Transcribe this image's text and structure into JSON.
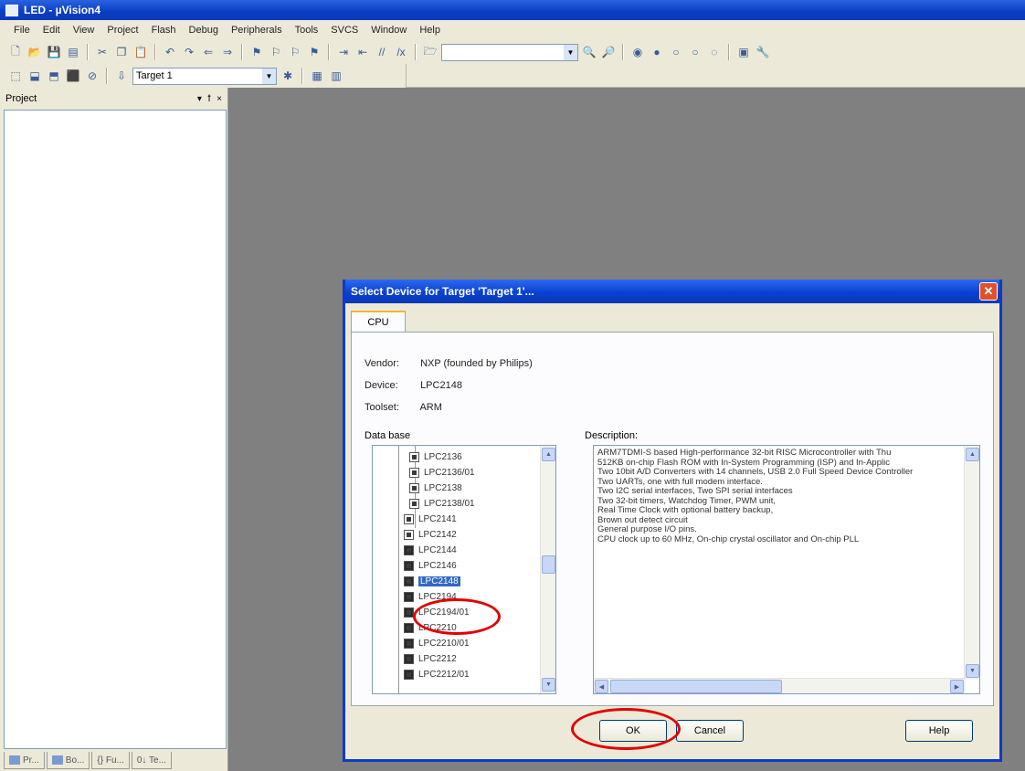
{
  "window": {
    "title": "LED - µVision4"
  },
  "menu": [
    "File",
    "Edit",
    "View",
    "Project",
    "Flash",
    "Debug",
    "Peripherals",
    "Tools",
    "SVCS",
    "Window",
    "Help"
  ],
  "toolbar2": {
    "target_value": "Target 1"
  },
  "project_panel": {
    "title": "Project",
    "controls": [
      "▾",
      "ꝉ",
      "×"
    ],
    "tabs": [
      "Pr...",
      "Bo...",
      "{} Fu...",
      "0↓ Te..."
    ]
  },
  "dialog": {
    "title": "Select Device for Target 'Target 1'...",
    "tab": "CPU",
    "vendor_label": "Vendor:",
    "vendor_value": "NXP (founded by Philips)",
    "device_label": "Device:",
    "device_value": "LPC2148",
    "toolset_label": "Toolset:",
    "toolset_value": "ARM",
    "database_label": "Data base",
    "description_label": "Description:",
    "database_items": [
      {
        "label": "LPC2136"
      },
      {
        "label": "LPC2136/01"
      },
      {
        "label": "LPC2138"
      },
      {
        "label": "LPC2138/01"
      },
      {
        "label": "LPC2141"
      },
      {
        "label": "LPC2142"
      },
      {
        "label": "LPC2144"
      },
      {
        "label": "LPC2146"
      },
      {
        "label": "LPC2148"
      },
      {
        "label": "LPC2194"
      },
      {
        "label": "LPC2194/01"
      },
      {
        "label": "LPC2210"
      },
      {
        "label": "LPC2210/01"
      },
      {
        "label": "LPC2212"
      },
      {
        "label": "LPC2212/01"
      }
    ],
    "description_lines": [
      "ARM7TDMI-S based High-performance 32-bit RISC Microcontroller with Thu",
      "512KB on-chip Flash ROM with In-System Programming (ISP) and In-Applic",
      "Two 10bit A/D Converters with 14 channels, USB 2.0 Full Speed Device Controller",
      "Two UARTs, one with full modem interface.",
      "Two I2C serial interfaces, Two SPI serial interfaces",
      "Two 32-bit timers, Watchdog Timer, PWM unit,",
      "Real Time Clock with optional battery backup,",
      "Brown out detect circuit",
      "General purpose I/O pins.",
      "CPU clock up to 60 MHz, On-chip crystal oscillator and On-chip PLL"
    ],
    "buttons": {
      "ok": "OK",
      "cancel": "Cancel",
      "help": "Help"
    }
  },
  "colors": {
    "titlebar": "#0a3cc6",
    "highlight_oval": "#e00000",
    "selection": "#316ac5"
  }
}
